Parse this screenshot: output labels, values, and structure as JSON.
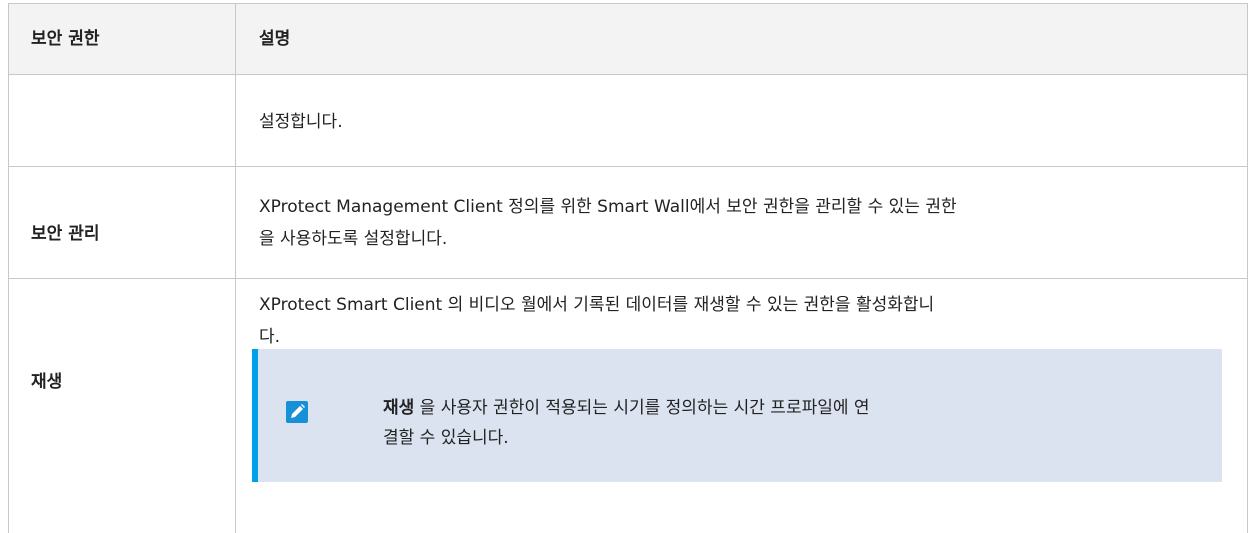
{
  "table": {
    "headers": {
      "col1": "보안 권한",
      "col2": "설명"
    },
    "rows": [
      {
        "name": "",
        "desc": "설정합니다."
      },
      {
        "name": "보안 관리",
        "desc_line1": "XProtect Management Client 정의를 위한 Smart Wall에서 보안 권한을 관리할 수 있는 권한",
        "desc_line2": "을 사용하도록 설정합니다."
      },
      {
        "name": "재생",
        "desc_line1": "XProtect Smart Client 의 비디오 월에서 기록된 데이터를 재생할 수 있는 권한을 활성화합니",
        "desc_line2": "다."
      }
    ]
  },
  "note": {
    "icon": "pencil-icon",
    "bold": "재생",
    "line1_rest": " 을 사용자 권한이 적용되는 시기를 정의하는 시간 프로파일에 연",
    "line2": "결할 수 있습니다."
  },
  "colors": {
    "accent": "#00a0e6",
    "note_bg": "#dce3f0",
    "header_bg": "#f3f3f3"
  }
}
